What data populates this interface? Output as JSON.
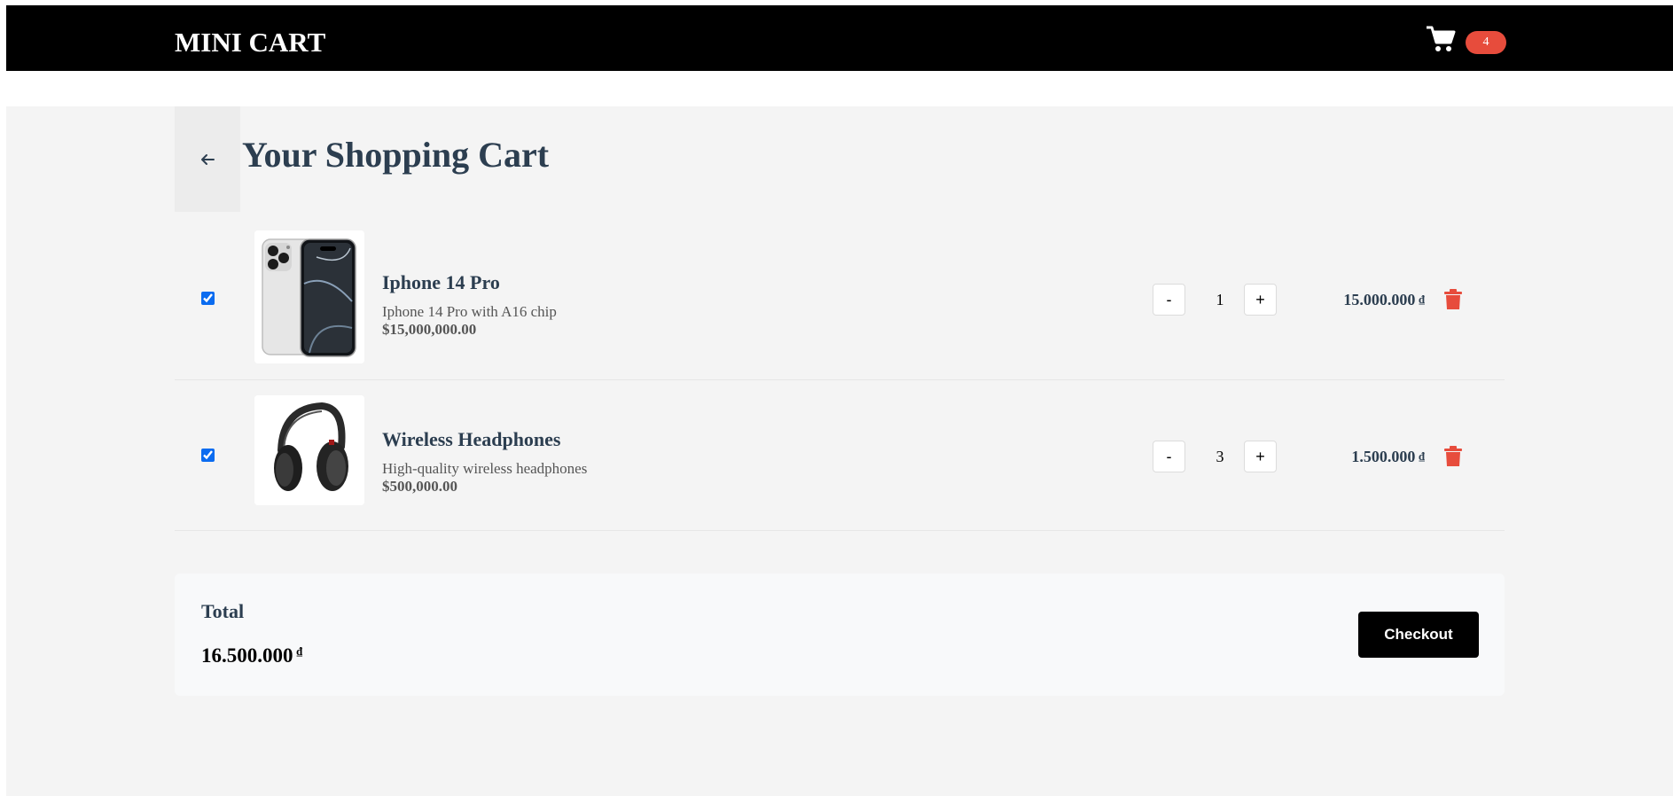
{
  "colors": {
    "header_bg": "#000000",
    "badge_bg": "#e74c3c",
    "title_text": "#2c3e50",
    "trash": "#e74c3c",
    "checkout_bg": "#000000"
  },
  "header": {
    "brand": "MINI CART",
    "cart_icon": "shopping-cart-icon",
    "cart_count": "4"
  },
  "page": {
    "title": "Your Shopping Cart",
    "back_icon": "arrow-left-icon"
  },
  "items": [
    {
      "checked": true,
      "image_icon": "phone-image",
      "name": "Iphone 14 Pro",
      "description": "Iphone 14 Pro with A16 chip",
      "unit_price": "$15,000,000.00",
      "decrease_label": "-",
      "quantity": "1",
      "increase_label": "+",
      "line_total": "15.000.000",
      "currency": "₫",
      "delete_icon": "trash-icon"
    },
    {
      "checked": true,
      "image_icon": "headphones-image",
      "name": "Wireless Headphones",
      "description": "High-quality wireless headphones",
      "unit_price": "$500,000.00",
      "decrease_label": "-",
      "quantity": "3",
      "increase_label": "+",
      "line_total": "1.500.000",
      "currency": "₫",
      "delete_icon": "trash-icon"
    }
  ],
  "summary": {
    "total_label": "Total",
    "total_value": "16.500.000",
    "currency": "₫",
    "checkout_label": "Checkout"
  }
}
